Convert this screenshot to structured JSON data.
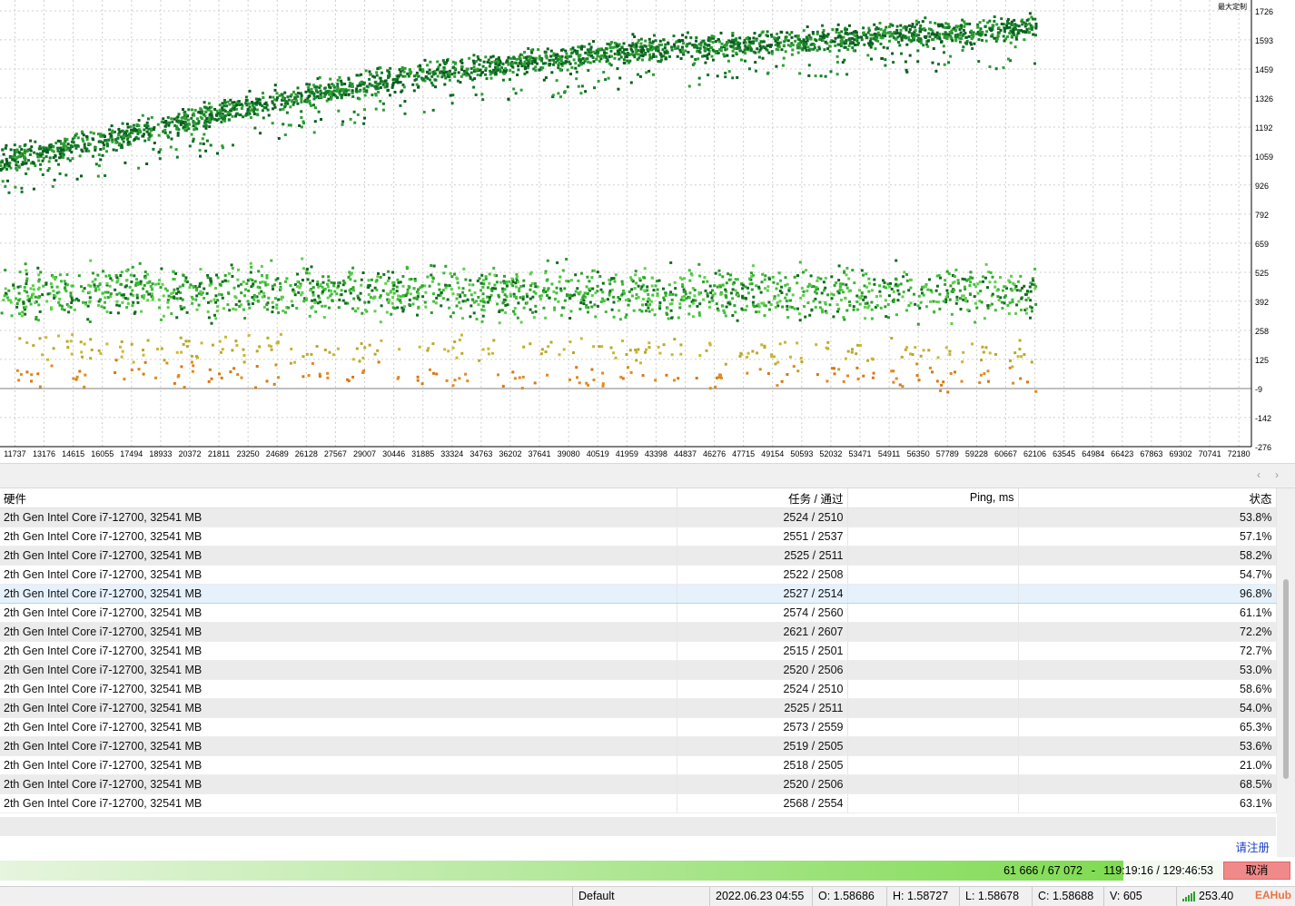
{
  "chart": {
    "axis_label_top": "最大定制",
    "y_ticks": [
      "1726",
      "1593",
      "1459",
      "1326",
      "1192",
      "1059",
      "926",
      "792",
      "659",
      "525",
      "392",
      "258",
      "125",
      "-9",
      "-142",
      "-276"
    ],
    "x_ticks": [
      "11737",
      "13176",
      "14615",
      "16055",
      "17494",
      "18933",
      "20372",
      "21811",
      "23250",
      "24689",
      "26128",
      "27567",
      "29007",
      "30446",
      "31885",
      "33324",
      "34763",
      "36202",
      "37641",
      "39080",
      "40519",
      "41959",
      "43398",
      "44837",
      "46276",
      "47715",
      "49154",
      "50593",
      "52032",
      "53471",
      "54911",
      "56350",
      "57789",
      "59228",
      "60667",
      "62106",
      "63545",
      "64984",
      "66423",
      "67863",
      "69302",
      "70741",
      "72180"
    ]
  },
  "scroll": {
    "left_arrow": "‹",
    "right_arrow": "›"
  },
  "table": {
    "headers": {
      "hardware": "硬件",
      "passes": "任务 / 通过",
      "ping": "Ping, ms",
      "state": "状态"
    },
    "rows": [
      {
        "hardware": "2th Gen Intel Core i7-12700, 32541 MB",
        "passes": "2524 / 2510",
        "ping": "",
        "state": "53.8%"
      },
      {
        "hardware": "2th Gen Intel Core i7-12700, 32541 MB",
        "passes": "2551 / 2537",
        "ping": "",
        "state": "57.1%"
      },
      {
        "hardware": "2th Gen Intel Core i7-12700, 32541 MB",
        "passes": "2525 / 2511",
        "ping": "",
        "state": "58.2%"
      },
      {
        "hardware": "2th Gen Intel Core i7-12700, 32541 MB",
        "passes": "2522 / 2508",
        "ping": "",
        "state": "54.7%"
      },
      {
        "hardware": "2th Gen Intel Core i7-12700, 32541 MB",
        "passes": "2527 / 2514",
        "ping": "",
        "state": "96.8%"
      },
      {
        "hardware": "2th Gen Intel Core i7-12700, 32541 MB",
        "passes": "2574 / 2560",
        "ping": "",
        "state": "61.1%"
      },
      {
        "hardware": "2th Gen Intel Core i7-12700, 32541 MB",
        "passes": "2621 / 2607",
        "ping": "",
        "state": "72.2%"
      },
      {
        "hardware": "2th Gen Intel Core i7-12700, 32541 MB",
        "passes": "2515 / 2501",
        "ping": "",
        "state": "72.7%"
      },
      {
        "hardware": "2th Gen Intel Core i7-12700, 32541 MB",
        "passes": "2520 / 2506",
        "ping": "",
        "state": "53.0%"
      },
      {
        "hardware": "2th Gen Intel Core i7-12700, 32541 MB",
        "passes": "2524 / 2510",
        "ping": "",
        "state": "58.6%"
      },
      {
        "hardware": "2th Gen Intel Core i7-12700, 32541 MB",
        "passes": "2525 / 2511",
        "ping": "",
        "state": "54.0%"
      },
      {
        "hardware": "2th Gen Intel Core i7-12700, 32541 MB",
        "passes": "2573 / 2559",
        "ping": "",
        "state": "65.3%"
      },
      {
        "hardware": "2th Gen Intel Core i7-12700, 32541 MB",
        "passes": "2519 / 2505",
        "ping": "",
        "state": "53.6%"
      },
      {
        "hardware": "2th Gen Intel Core i7-12700, 32541 MB",
        "passes": "2518 / 2505",
        "ping": "",
        "state": "21.0%"
      },
      {
        "hardware": "2th Gen Intel Core i7-12700, 32541 MB",
        "passes": "2520 / 2506",
        "ping": "",
        "state": "68.5%"
      },
      {
        "hardware": "2th Gen Intel Core i7-12700, 32541 MB",
        "passes": "2568 / 2554",
        "ping": "",
        "state": "63.1%"
      }
    ],
    "selected_row": 4,
    "register_link": "请注册"
  },
  "progress": {
    "count": "61 666 / 67 072",
    "separator": "-",
    "time": "119:19:16 / 129:46:53",
    "fraction": 0.919,
    "cancel_label": "取消"
  },
  "status_bar": {
    "profile": "Default",
    "datetime": "2022.06.23 04:55",
    "open": "O: 1.58686",
    "high": "H: 1.58727",
    "low": "L: 1.58678",
    "close": "C: 1.58688",
    "volume": "V: 605",
    "speed": "253.40",
    "logo": "EAHub"
  },
  "colors": {
    "dark_green": "#0b5d1e",
    "mid_green": "#1f8f2a",
    "light_green": "#3dbf3a",
    "olive": "#b8a92a",
    "orange": "#e08a1e",
    "selected_row": "#e5f1fb",
    "cancel_button": "#f08a8a"
  },
  "chart_data": {
    "type": "scatter",
    "title": "",
    "xlabel": "",
    "ylabel": "最大定制",
    "xlim": [
      11000,
      72800
    ],
    "ylim": [
      -276,
      1726
    ],
    "y_ticks": [
      1726,
      1593,
      1459,
      1326,
      1192,
      1059,
      926,
      792,
      659,
      525,
      392,
      258,
      125,
      -9,
      -142,
      -276
    ],
    "grid": true,
    "series": [
      {
        "color": "#0b5d1e",
        "x": [
          10960,
          13176,
          16055,
          18933,
          21811,
          24689,
          27567,
          30446,
          33324,
          36202,
          39080,
          41959,
          44837,
          47715,
          50593,
          53471,
          56350,
          59228,
          60667,
          62106
        ],
        "y": [
          1040,
          1085,
          1140,
          1200,
          1260,
          1320,
          1365,
          1420,
          1460,
          1490,
          1520,
          1548,
          1565,
          1580,
          1595,
          1610,
          1625,
          1640,
          1650,
          1662
        ]
      },
      {
        "color": "#3dbf3a",
        "x": [
          10960,
          16055,
          21811,
          27567,
          33324,
          39080,
          44837,
          50593,
          56350,
          62106
        ],
        "y": [
          420,
          440,
          445,
          450,
          440,
          435,
          430,
          440,
          435,
          440
        ]
      },
      {
        "color": "#b8a92a",
        "x": [
          11737,
          20372,
          29007,
          37641,
          46276,
          54911,
          62106
        ],
        "y": [
          190,
          175,
          170,
          180,
          165,
          170,
          160
        ]
      },
      {
        "color": "#e08a1e",
        "x": [
          11737,
          20372,
          29007,
          37641,
          46276,
          54911,
          62106
        ],
        "y": [
          60,
          65,
          55,
          50,
          45,
          50,
          40
        ]
      }
    ]
  }
}
